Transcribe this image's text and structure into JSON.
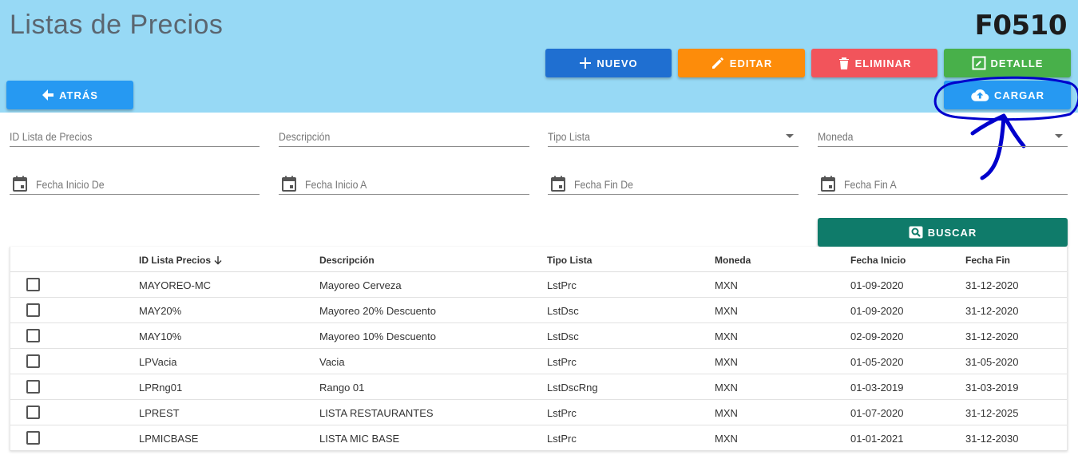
{
  "header": {
    "title": "Listas de Precios",
    "code": "F0510"
  },
  "toolbar": {
    "nuevo": "NUEVO",
    "editar": "EDITAR",
    "eliminar": "ELIMINAR",
    "detalle": "DETALLE",
    "atras": "ATRÁS",
    "cargar": "CARGAR",
    "buscar": "BUSCAR"
  },
  "colors": {
    "header_bg": "#97d9f5",
    "nuevo": "#1f6fd1",
    "editar": "#fd8c0a",
    "eliminar": "#f2545b",
    "detalle": "#48b04a",
    "atras": "#2699f2",
    "cargar": "#2699f2",
    "buscar": "#0f7b6a",
    "annotation": "#0000cc"
  },
  "filters": {
    "id_lista": "ID Lista de Precios",
    "descripcion": "Descripción",
    "tipo_lista": "Tipo Lista",
    "moneda": "Moneda",
    "fecha_inicio_de": "Fecha Inicio De",
    "fecha_inicio_a": "Fecha Inicio A",
    "fecha_fin_de": "Fecha Fin De",
    "fecha_fin_a": "Fecha Fin A"
  },
  "table": {
    "columns": [
      "ID Lista Precios",
      "Descripción",
      "Tipo Lista",
      "Moneda",
      "Fecha Inicio",
      "Fecha Fin"
    ],
    "sort_icon": "arrow-down-icon",
    "rows": [
      [
        "MAYOREO-MC",
        "Mayoreo Cerveza",
        "LstPrc",
        "MXN",
        "01-09-2020",
        "31-12-2020"
      ],
      [
        "MAY20%",
        "Mayoreo 20% Descuento",
        "LstDsc",
        "MXN",
        "01-09-2020",
        "31-12-2020"
      ],
      [
        "MAY10%",
        "Mayoreo 10% Descuento",
        "LstDsc",
        "MXN",
        "02-09-2020",
        "31-12-2020"
      ],
      [
        "LPVacia",
        "Vacia",
        "LstPrc",
        "MXN",
        "01-05-2020",
        "31-05-2020"
      ],
      [
        "LPRng01",
        "Rango 01",
        "LstDscRng",
        "MXN",
        "01-03-2019",
        "31-03-2019"
      ],
      [
        "LPREST",
        "LISTA RESTAURANTES",
        "LstPrc",
        "MXN",
        "01-07-2020",
        "31-12-2025"
      ],
      [
        "LPMICBASE",
        "LISTA MIC BASE",
        "LstPrc",
        "MXN",
        "01-01-2021",
        "31-12-2030"
      ]
    ]
  }
}
